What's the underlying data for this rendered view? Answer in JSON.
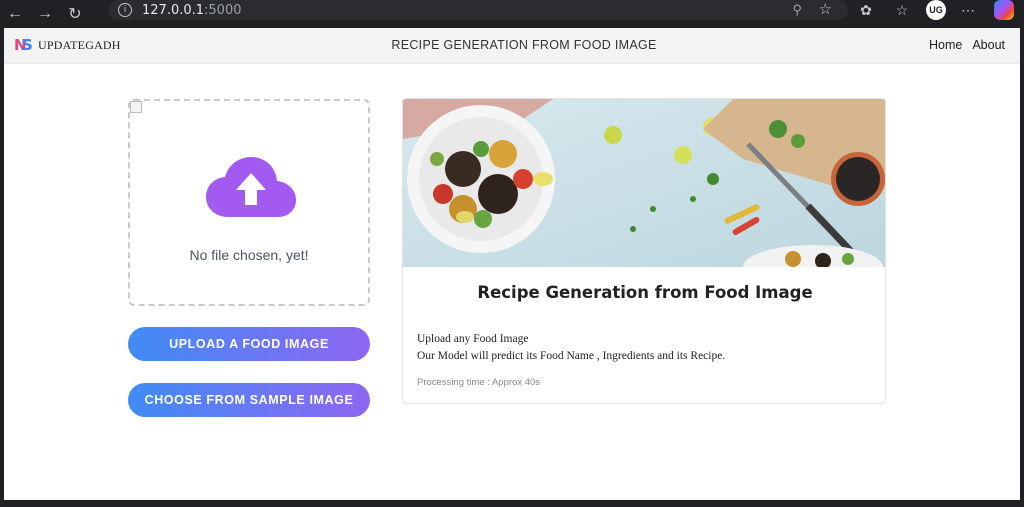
{
  "browser": {
    "url_host": "127.0.0.1",
    "url_port": ":5000",
    "profile_initials": "UG"
  },
  "navbar": {
    "brand_name": "UPDATEGADH",
    "brand_logo_n": "N",
    "brand_logo_s": "S",
    "title": "RECIPE GENERATION FROM FOOD IMAGE",
    "links": [
      "Home",
      "About"
    ]
  },
  "upload": {
    "status": "No file chosen, yet!",
    "upload_button": "UPLOAD A FOOD IMAGE",
    "sample_button": "CHOOSE FROM SAMPLE IMAGE"
  },
  "card": {
    "title": "Recipe Generation from Food Image",
    "line1": "Upload any Food Image",
    "line2": "Our Model will predict its Food Name , Ingredients and its Recipe.",
    "meta": "Processing time : Approx 40s"
  },
  "colors": {
    "button_start": "#3f8cf5",
    "button_end": "#8e66f2",
    "cloud": "#a25af0"
  }
}
